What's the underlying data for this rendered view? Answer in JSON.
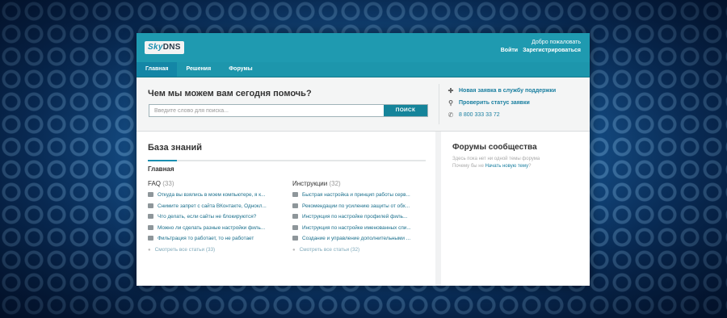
{
  "logo": {
    "part1": "Sky",
    "part2": "DNS"
  },
  "header": {
    "welcome": "Добро пожаловать",
    "login": "Войти",
    "register": "Зарегистрироваться"
  },
  "nav": {
    "tabs": [
      "Главная",
      "Решения",
      "Форумы"
    ],
    "active": 0
  },
  "help": {
    "title": "Чем мы можем вам сегодня помочь?",
    "search_placeholder": "Введите слово для поиска...",
    "search_button": "ПОИСК"
  },
  "quick_links": {
    "new_ticket": "Новая заявка в службу поддержки",
    "check_status": "Проверить статус заявки",
    "phone": "8 800 333 33 72"
  },
  "kb": {
    "title": "База знаний",
    "section": "Главная",
    "faq": {
      "name": "FAQ",
      "count": "(33)",
      "articles": [
        "Откуда вы взялись в моем компьютере, я к...",
        "Снимите запрет с сайта ВКонтакте, Однокл...",
        "Что делать, если сайты не блокируются?",
        "Можно ли сделать разные настройки филь...",
        "Фильтрация то работает, то не работает"
      ],
      "see_all": "Смотреть все статьи (33)"
    },
    "instructions": {
      "name": "Инструкции",
      "count": "(32)",
      "articles": [
        "Быстрая настройка и принцип работы серв...",
        "Рекомендации по усилению защиты от обх...",
        "Инструкция по настройке профилей филь...",
        "Инструкция по настройке именованных спи...",
        "Создание и управление дополнительными ..."
      ],
      "see_all": "Смотреть все статьи (32)"
    }
  },
  "forums": {
    "title": "Форумы сообщества",
    "empty_line1": "Здесь пока нет ни одной темы форума",
    "empty_line2": "Почему бы не",
    "empty_link": "Начать новую тему",
    "empty_end": "?"
  },
  "colors": {
    "header": "#1f9ab0",
    "nav_active": "#1486a6",
    "button": "#15849a",
    "link": "#1a7fa0"
  }
}
